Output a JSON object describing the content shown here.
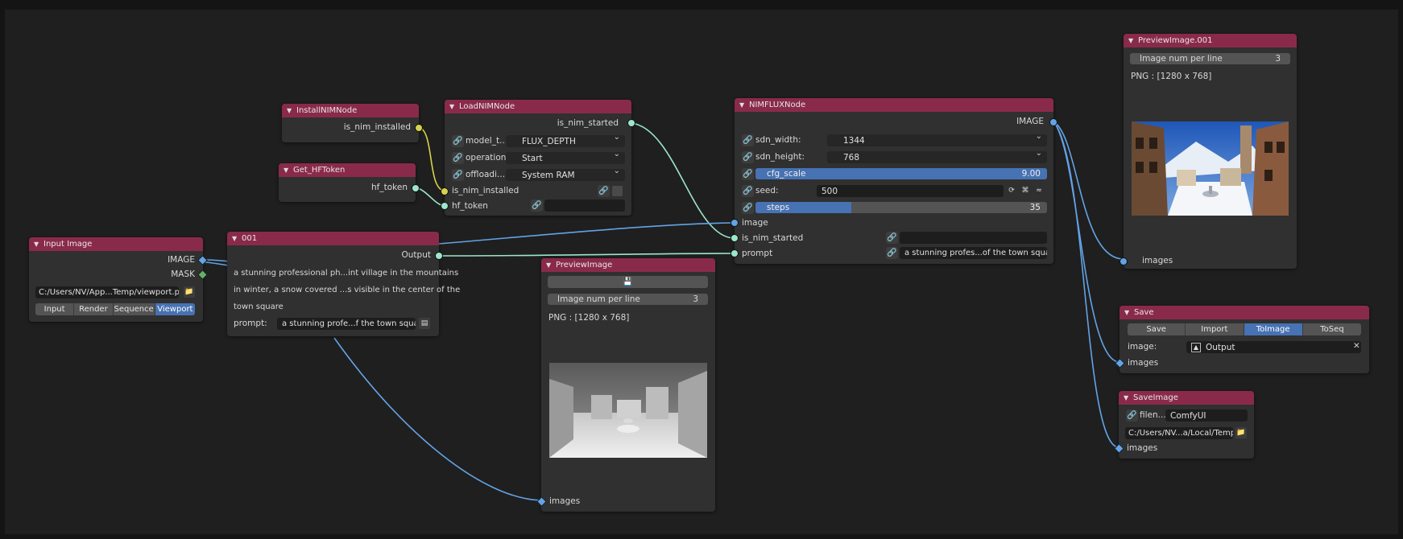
{
  "install_nim": {
    "title": "InstallNIMNode",
    "out_is_nim_installed": "is_nim_installed"
  },
  "get_hf": {
    "title": "Get_HFToken",
    "out_hf_token": "hf_token"
  },
  "load_nim": {
    "title": "LoadNIMNode",
    "out_is_nim_started": "is_nim_started",
    "model_label": "model_t...",
    "model_value": "FLUX_DEPTH",
    "operation_label": "operation:",
    "operation_value": "Start",
    "offload_label": "offloadi...",
    "offload_value": "System RAM",
    "in_is_nim_installed": "is_nim_installed",
    "in_hf_token": "hf_token"
  },
  "input_image": {
    "title": "Input Image",
    "out_image": "IMAGE",
    "out_mask": "MASK",
    "path": "C:/Users/NV/App...Temp/viewport.png",
    "modes": [
      "Input",
      "Render",
      "Sequence",
      "Viewport"
    ],
    "active_mode": "Viewport"
  },
  "text_node": {
    "title": "001",
    "out_output": "Output",
    "lines": [
      "a stunning professional ph...int village in the mountains",
      "in winter, a snow covered ...s visible in the center of the",
      "town square"
    ],
    "prompt_label": "prompt:",
    "prompt_value": "a stunning profe...f the town square"
  },
  "preview": {
    "title": "PreviewImage",
    "per_line_label": "Image num per line",
    "per_line_value": "3",
    "info": "PNG : [1280 x 768]",
    "in_images": "images"
  },
  "flux": {
    "title": "NIMFLUXNode",
    "out_image": "IMAGE",
    "width_label": "sdn_width:",
    "width_value": "1344",
    "height_label": "sdn_height:",
    "height_value": "768",
    "cfg_label": "cfg_scale",
    "cfg_value": "9.00",
    "cfg_fraction": 1.0,
    "seed_label": "seed:",
    "seed_value": "500",
    "steps_label": "steps",
    "steps_value": "35",
    "steps_fraction": 0.33,
    "in_image": "image",
    "in_is_nim_started": "is_nim_started",
    "in_prompt": "prompt",
    "prompt_value": "a stunning profes...of the town square"
  },
  "preview2": {
    "title": "PreviewImage.001",
    "per_line_label": "Image num per line",
    "per_line_value": "3",
    "info": "PNG : [1280 x 768]",
    "in_images": "images"
  },
  "save": {
    "title": "Save",
    "modes": [
      "Save",
      "Import",
      "ToImage",
      "ToSeq"
    ],
    "active_mode": "ToImage",
    "image_label": "image:",
    "image_value": "Output",
    "in_images": "images"
  },
  "save_image": {
    "title": "SaveImage",
    "filename_label": "filen...",
    "filename_value": "ComfyUI",
    "path": "C:/Users/NV...a/Local/Temp",
    "in_images": "images"
  }
}
